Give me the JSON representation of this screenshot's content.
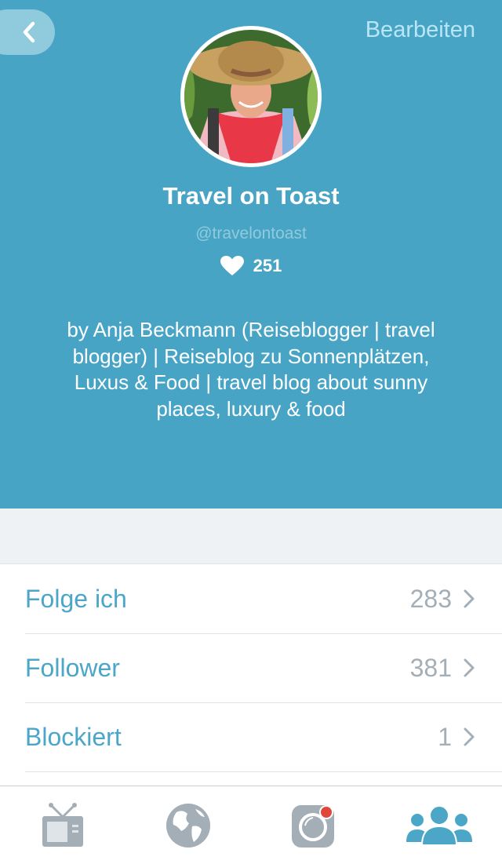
{
  "header": {
    "back_icon": "chevron-left-icon",
    "edit_label": "Bearbeiten",
    "profile": {
      "name": "Travel on Toast",
      "handle": "@travelontoast",
      "likes_icon": "heart-icon",
      "likes": "251",
      "bio": "by Anja Beckmann (Reiseblogger | travel blogger) | Reiseblog zu Sonnenplätzen, Luxus & Food | travel blog about sunny places, luxury & food"
    }
  },
  "list": {
    "rows": [
      {
        "label": "Folge ich",
        "count": "283"
      },
      {
        "label": "Follower",
        "count": "381"
      },
      {
        "label": "Blockiert",
        "count": "1"
      }
    ]
  },
  "tabbar": {
    "tabs": [
      {
        "icon": "tv-icon",
        "active": false
      },
      {
        "icon": "globe-icon",
        "active": false
      },
      {
        "icon": "camera-icon",
        "active": false,
        "badge": true
      },
      {
        "icon": "people-icon",
        "active": true
      }
    ]
  },
  "colors": {
    "header_bg": "#48a4c5",
    "accent": "#4ba6c7",
    "muted": "#a4aeb6",
    "badge": "#e0463a"
  }
}
